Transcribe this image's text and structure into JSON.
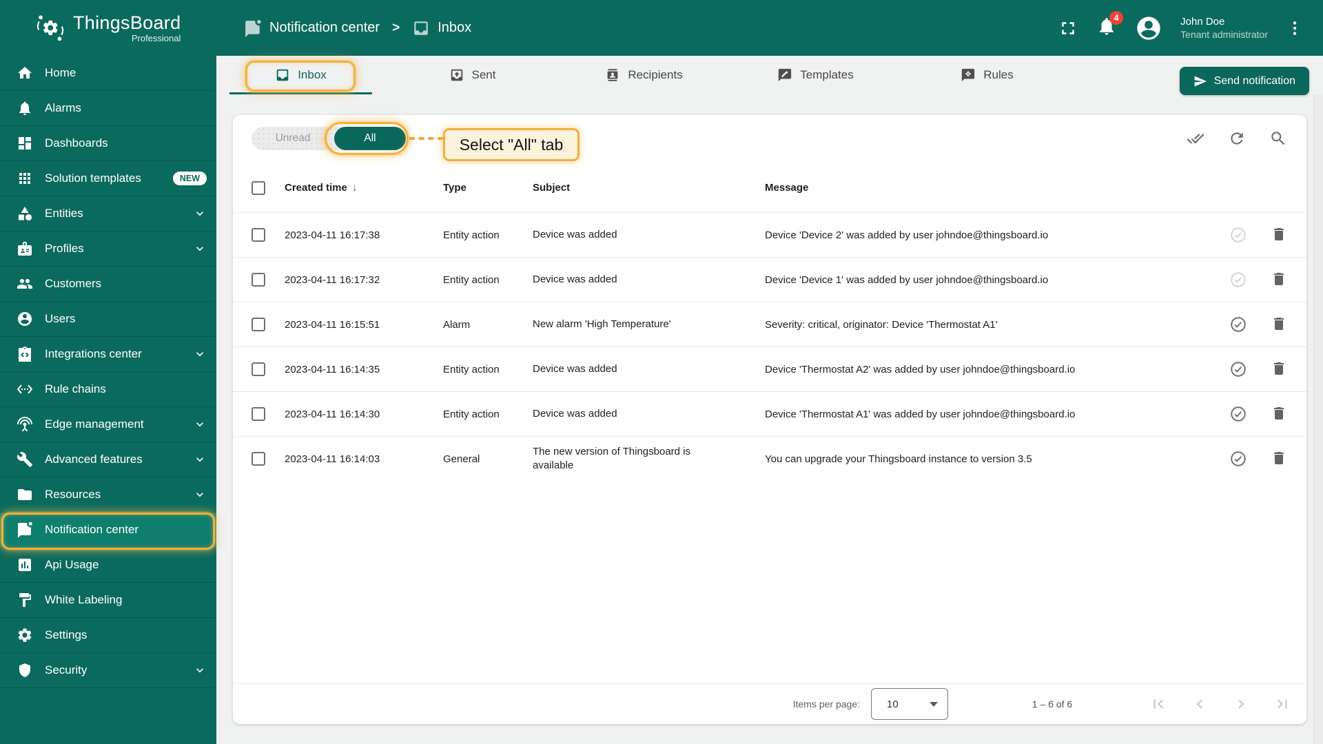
{
  "app": {
    "brand": "ThingsBoard",
    "brand_sub": "Professional"
  },
  "colors": {
    "primary_teal": "#0b6a5e",
    "active_item_teal": "#0e7e6e",
    "annotation_orange": "#f3b13f",
    "annotation_cream": "#fcf3dd",
    "badge_red": "#ef4237"
  },
  "header": {
    "breadcrumb": [
      {
        "label": "Notification center",
        "icon": "chat-dot-icon"
      },
      {
        "label": "Inbox",
        "icon": "inbox-icon"
      }
    ],
    "separator": ">",
    "notifications_badge": "4",
    "user": {
      "name": "John Doe",
      "role": "Tenant administrator"
    },
    "icons": [
      "fullscreen-icon",
      "bell-icon",
      "avatar-icon",
      "more-vert-icon"
    ]
  },
  "sidebar": {
    "items": [
      {
        "label": "Home",
        "icon": "home"
      },
      {
        "label": "Alarms",
        "icon": "bell"
      },
      {
        "label": "Dashboards",
        "icon": "dashboard"
      },
      {
        "label": "Solution templates",
        "icon": "apps",
        "badge": "NEW"
      },
      {
        "label": "Entities",
        "icon": "category",
        "chevron": true
      },
      {
        "label": "Profiles",
        "icon": "badge",
        "chevron": true
      },
      {
        "label": "Customers",
        "icon": "people"
      },
      {
        "label": "Users",
        "icon": "account-circle"
      },
      {
        "label": "Integrations center",
        "icon": "integration",
        "chevron": true
      },
      {
        "label": "Rule chains",
        "icon": "ethernet"
      },
      {
        "label": "Edge management",
        "icon": "antenna",
        "chevron": true
      },
      {
        "label": "Advanced features",
        "icon": "wrench",
        "chevron": true
      },
      {
        "label": "Resources",
        "icon": "folder",
        "chevron": true
      },
      {
        "label": "Notification center",
        "icon": "chat-dot",
        "active": true
      },
      {
        "label": "Api Usage",
        "icon": "poll"
      },
      {
        "label": "White Labeling",
        "icon": "paint-roller"
      },
      {
        "label": "Settings",
        "icon": "gear"
      },
      {
        "label": "Security",
        "icon": "shield",
        "chevron": true
      }
    ]
  },
  "tabs": {
    "items": [
      {
        "label": "Inbox",
        "icon": "inbox",
        "active": true
      },
      {
        "label": "Sent",
        "icon": "outbox"
      },
      {
        "label": "Recipients",
        "icon": "recipients"
      },
      {
        "label": "Templates",
        "icon": "template"
      },
      {
        "label": "Rules",
        "icon": "rule"
      }
    ],
    "send_button": "Send notification"
  },
  "filters": {
    "unread": "Unread",
    "all": "All",
    "selected": "All"
  },
  "annotations": {
    "select_all_label": "Select \"All\" tab"
  },
  "toolbar_icons": [
    "mark-all-read-icon",
    "refresh-icon",
    "search-icon"
  ],
  "table": {
    "headers": {
      "created": "Created time",
      "type": "Type",
      "subject": "Subject",
      "message": "Message"
    },
    "sort": {
      "column": "Created time",
      "direction": "desc",
      "glyph": "↓"
    },
    "rows": [
      {
        "created": "2023-04-11 16:17:38",
        "type": "Entity action",
        "subject": "Device was added",
        "message": "Device 'Device 2' was added by user johndoe@thingsboard.io",
        "read": true
      },
      {
        "created": "2023-04-11 16:17:32",
        "type": "Entity action",
        "subject": "Device was added",
        "message": "Device 'Device 1' was added by user johndoe@thingsboard.io",
        "read": true
      },
      {
        "created": "2023-04-11 16:15:51",
        "type": "Alarm",
        "subject": "New alarm 'High Temperature'",
        "message": "Severity: critical, originator: Device 'Thermostat A1'",
        "read": false
      },
      {
        "created": "2023-04-11 16:14:35",
        "type": "Entity action",
        "subject": "Device was added",
        "message": "Device 'Thermostat A2' was added by user johndoe@thingsboard.io",
        "read": false
      },
      {
        "created": "2023-04-11 16:14:30",
        "type": "Entity action",
        "subject": "Device was added",
        "message": "Device 'Thermostat A1' was added by user johndoe@thingsboard.io",
        "read": false
      },
      {
        "created": "2023-04-11 16:14:03",
        "type": "General",
        "subject": "The new version of Thingsboard is available",
        "message": "You can upgrade your Thingsboard instance to version 3.5",
        "read": false
      }
    ]
  },
  "pagination": {
    "items_per_page_label": "Items per page:",
    "page_size": "10",
    "range": "1 – 6 of 6"
  }
}
